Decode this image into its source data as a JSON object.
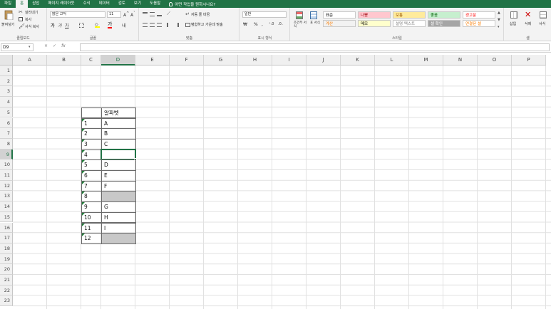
{
  "ribbon_tabs": [
    "파일",
    "홈",
    "삽입",
    "페이지 레이아웃",
    "수식",
    "데이터",
    "검토",
    "보기",
    "도움말"
  ],
  "active_tab": "홈",
  "tell_me": "어떤 작업을 원하시나요?",
  "clipboard": {
    "paste": "붙여넣기",
    "cut": "잘라내기",
    "copy": "복사",
    "format_painter": "서식 복사",
    "label": "클립보드"
  },
  "font": {
    "name": "맑은 고딕",
    "size": "11",
    "label": "글꼴"
  },
  "alignment": {
    "wrap": "자동 줄 바꿈",
    "merge": "병합하고 가운데 맞춤",
    "label": "맞춤"
  },
  "number": {
    "format": "일반",
    "label": "표시 형식"
  },
  "styles": {
    "conditional": "조건부 서식",
    "table": "표 서식",
    "label": "스타일",
    "cells": [
      {
        "text": "표준",
        "bg": "#ffffff",
        "color": "#000000"
      },
      {
        "text": "나쁨",
        "bg": "#ffc7ce",
        "color": "#9c0006"
      },
      {
        "text": "보통",
        "bg": "#ffeb9c",
        "color": "#9c5700"
      },
      {
        "text": "좋음",
        "bg": "#c6efce",
        "color": "#006100"
      },
      {
        "text": "경고문",
        "bg": "#ffffff",
        "color": "#ff0000"
      },
      {
        "text": "계산",
        "bg": "#f2f2f2",
        "color": "#fa7d00"
      },
      {
        "text": "메모",
        "bg": "#ffffcc",
        "color": "#000000"
      },
      {
        "text": "설명 텍스트",
        "bg": "#ffffff",
        "color": "#7f7f7f"
      },
      {
        "text": "셀 확인",
        "bg": "#a5a5a5",
        "color": "#ffffff"
      },
      {
        "text": "연결된 셀",
        "bg": "#ffffff",
        "color": "#fa7d00"
      }
    ]
  },
  "cells_group": {
    "insert": "삽입",
    "delete": "삭제",
    "format": "서식",
    "label": "셀"
  },
  "name_box": "D9",
  "formula_bar": {
    "cancel": "×",
    "enter": "✓",
    "fx": "fx",
    "value": ""
  },
  "columns": [
    "A",
    "B",
    "C",
    "D",
    "E",
    "F",
    "G",
    "H",
    "I",
    "J",
    "K",
    "L",
    "M",
    "N",
    "O",
    "P"
  ],
  "rows": [
    "1",
    "2",
    "3",
    "4",
    "5",
    "6",
    "7",
    "8",
    "9",
    "10",
    "11",
    "12",
    "13",
    "14",
    "15",
    "16",
    "17",
    "18",
    "19",
    "20",
    "21",
    "22",
    "23"
  ],
  "selected_cell": "D9",
  "table": {
    "header": "알파벳",
    "rows": [
      {
        "num": "1",
        "letter": "A",
        "blank": false
      },
      {
        "num": "2",
        "letter": "B",
        "blank": false
      },
      {
        "num": "3",
        "letter": "C",
        "blank": false
      },
      {
        "num": "4",
        "letter": "",
        "blank": true,
        "selected": true
      },
      {
        "num": "5",
        "letter": "D",
        "blank": false
      },
      {
        "num": "6",
        "letter": "E",
        "blank": false
      },
      {
        "num": "7",
        "letter": "F",
        "blank": false
      },
      {
        "num": "8",
        "letter": "",
        "blank": true
      },
      {
        "num": "9",
        "letter": "G",
        "blank": false
      },
      {
        "num": "10",
        "letter": "H",
        "blank": false
      },
      {
        "num": "11",
        "letter": "I",
        "blank": false
      },
      {
        "num": "12",
        "letter": "",
        "blank": true
      }
    ]
  },
  "colors": {
    "accent": "#217346",
    "blank_fill": "#c8c8c8"
  }
}
